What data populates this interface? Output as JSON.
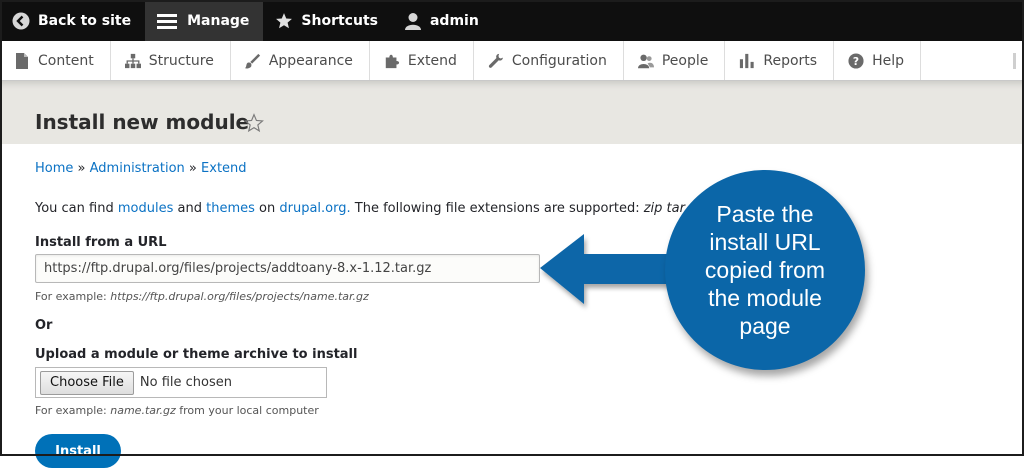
{
  "toolbar": {
    "back_label": "Back to site",
    "manage_label": "Manage",
    "shortcuts_label": "Shortcuts",
    "user_label": "admin"
  },
  "tray": {
    "items": [
      {
        "label": "Content",
        "icon": "file-icon"
      },
      {
        "label": "Structure",
        "icon": "sitemap-icon"
      },
      {
        "label": "Appearance",
        "icon": "paintbrush-icon"
      },
      {
        "label": "Extend",
        "icon": "puzzle-icon"
      },
      {
        "label": "Configuration",
        "icon": "wrench-icon"
      },
      {
        "label": "People",
        "icon": "people-icon"
      },
      {
        "label": "Reports",
        "icon": "bar-chart-icon"
      },
      {
        "label": "Help",
        "icon": "help-icon"
      }
    ]
  },
  "page": {
    "title": "Install new module"
  },
  "breadcrumb": {
    "home": "Home",
    "sep": "»",
    "administration": "Administration",
    "extend": "Extend"
  },
  "intro": {
    "prefix": "You can find",
    "modules_link": "modules",
    "and": "and",
    "themes_link": "themes",
    "on": "on",
    "drupal_link": "drupal.org.",
    "suffix": "The following file extensions are supported:",
    "extensions": "zip tar t"
  },
  "url_field": {
    "label": "Install from a URL",
    "value": "https://ftp.drupal.org/files/projects/addtoany-8.x-1.12.tar.gz",
    "hint_prefix": "For example:",
    "hint_example": "https://ftp.drupal.org/files/projects/name.tar.gz"
  },
  "or_label": "Or",
  "upload_field": {
    "label": "Upload a module or theme archive to install",
    "choose_label": "Choose File",
    "no_file_label": "No file chosen",
    "hint_prefix": "For example:",
    "hint_example": "name.tar.gz",
    "hint_suffix": "from your local computer"
  },
  "install_label": "Install",
  "callout": {
    "text": "Paste the install URL copied from the module page",
    "color": "#0b66a8"
  },
  "colors": {
    "link": "#0b72c4",
    "primary_button": "#0071b8",
    "toolbar_bg": "#0f0f0f",
    "header_bg": "#e8e7e2"
  }
}
